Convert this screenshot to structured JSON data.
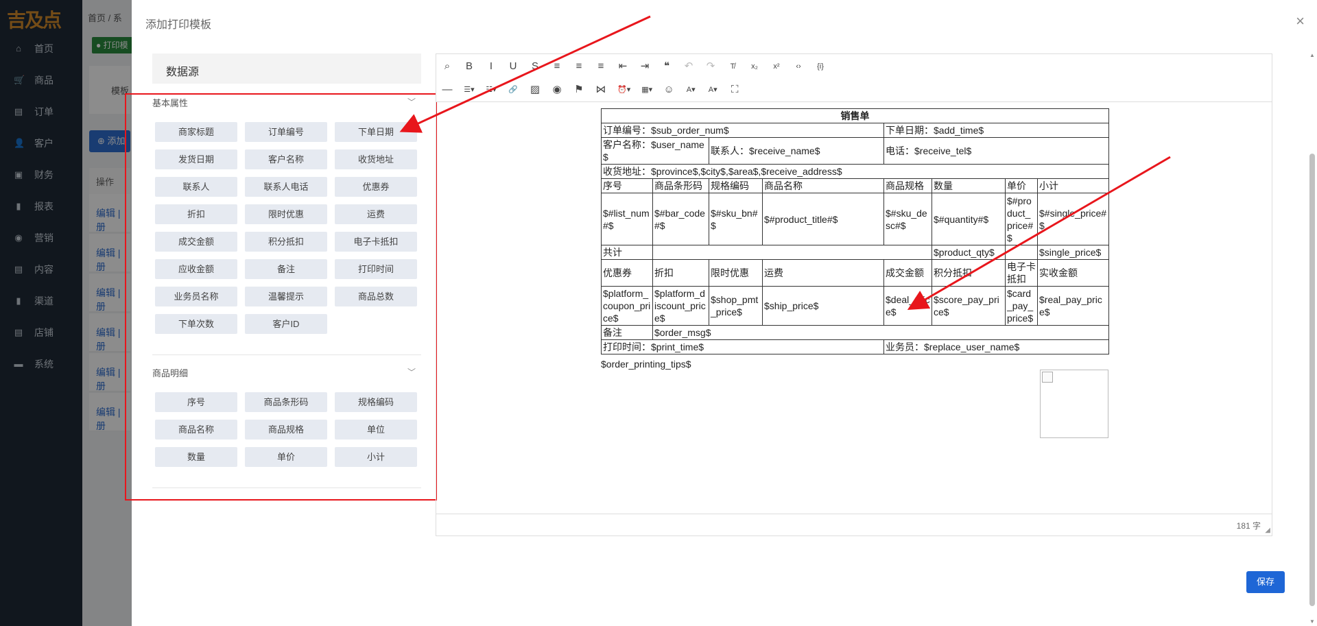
{
  "logo": "吉及点",
  "sidebar": {
    "items": [
      {
        "label": "首页",
        "icon": "home-icon",
        "glyph": "⌂"
      },
      {
        "label": "商品",
        "icon": "cart-icon",
        "glyph": "🛒"
      },
      {
        "label": "订单",
        "icon": "order-icon",
        "glyph": "▤"
      },
      {
        "label": "客户",
        "icon": "user-icon",
        "glyph": "👤"
      },
      {
        "label": "财务",
        "icon": "finance-icon",
        "glyph": "▣"
      },
      {
        "label": "报表",
        "icon": "report-icon",
        "glyph": "▮"
      },
      {
        "label": "营销",
        "icon": "marketing-icon",
        "glyph": "◉"
      },
      {
        "label": "内容",
        "icon": "content-icon",
        "glyph": "▤"
      },
      {
        "label": "渠道",
        "icon": "channel-icon",
        "glyph": "▮"
      },
      {
        "label": "店铺",
        "icon": "store-icon",
        "glyph": "▤"
      },
      {
        "label": "系统",
        "icon": "system-icon",
        "glyph": "▬"
      }
    ]
  },
  "background": {
    "breadcrumb": "首页 / 系",
    "tag": "● 打印模",
    "card_label": "模板",
    "add_button": "⊕ 添加",
    "table_header": "操作",
    "row_action": "编辑 | 册"
  },
  "dialog": {
    "title": "添加打印模板",
    "close_glyph": "×",
    "datasource_title": "数据源",
    "sections": [
      {
        "title": "基本属性",
        "fields": [
          "商家标题",
          "订单编号",
          "下单日期",
          "发货日期",
          "客户名称",
          "收货地址",
          "联系人",
          "联系人电话",
          "优惠券",
          "折扣",
          "限时优惠",
          "运费",
          "成交金额",
          "积分抵扣",
          "电子卡抵扣",
          "应收金额",
          "备注",
          "打印时间",
          "业务员名称",
          "温馨提示",
          "商品总数",
          "下单次数",
          "客户ID"
        ]
      },
      {
        "title": "商品明细",
        "fields": [
          "序号",
          "商品条形码",
          "规格编码",
          "商品名称",
          "商品规格",
          "单位",
          "数量",
          "单价",
          "小计"
        ]
      }
    ],
    "save_label": "保存"
  },
  "editor": {
    "word_count": "181 字",
    "toolbar_row1": [
      {
        "name": "find-icon",
        "glyph": "⌕"
      },
      {
        "name": "bold-icon",
        "glyph": "B"
      },
      {
        "name": "italic-icon",
        "glyph": "I"
      },
      {
        "name": "underline-icon",
        "glyph": "U"
      },
      {
        "name": "strikethrough-icon",
        "glyph": "S"
      },
      {
        "name": "align-left-icon",
        "glyph": "≡"
      },
      {
        "name": "align-center-icon",
        "glyph": "≡"
      },
      {
        "name": "align-right-icon",
        "glyph": "≡"
      },
      {
        "name": "outdent-icon",
        "glyph": "⇤"
      },
      {
        "name": "indent-icon",
        "glyph": "⇥"
      },
      {
        "name": "blockquote-icon",
        "glyph": "❝"
      },
      {
        "name": "undo-icon",
        "glyph": "↶",
        "disabled": true
      },
      {
        "name": "redo-icon",
        "glyph": "↷",
        "disabled": true
      },
      {
        "name": "clear-format-icon",
        "glyph": "T̸"
      },
      {
        "name": "subscript-icon",
        "glyph": "x₂"
      },
      {
        "name": "superscript-icon",
        "glyph": "x²"
      },
      {
        "name": "code-icon",
        "glyph": "‹›"
      },
      {
        "name": "source-icon",
        "glyph": "{i}"
      }
    ],
    "toolbar_row2": [
      {
        "name": "horizontal-rule-icon",
        "glyph": "—"
      },
      {
        "name": "bullet-list-icon",
        "glyph": "☰▾"
      },
      {
        "name": "numbered-list-icon",
        "glyph": "☷▾"
      },
      {
        "name": "link-icon",
        "glyph": "🔗"
      },
      {
        "name": "image-icon",
        "glyph": "▨"
      },
      {
        "name": "preview-icon",
        "glyph": "◉"
      },
      {
        "name": "bookmark-icon",
        "glyph": "⚑"
      },
      {
        "name": "page-break-icon",
        "glyph": "⋈"
      },
      {
        "name": "datetime-icon",
        "glyph": "⏰▾"
      },
      {
        "name": "table-icon",
        "glyph": "▦▾"
      },
      {
        "name": "emoji-icon",
        "glyph": "☺"
      },
      {
        "name": "font-color-icon",
        "glyph": "A▾"
      },
      {
        "name": "background-color-icon",
        "glyph": "A▾"
      },
      {
        "name": "fullscreen-icon",
        "glyph": "⛶"
      }
    ],
    "doc": {
      "title": "销售单",
      "order_no": "订单编号：$sub_order_num$",
      "order_date": "下单日期：$add_time$",
      "customer_name": "客户名称：$user_name$",
      "contact": "联系人：$receive_name$",
      "phone": "电话：$receive_tel$",
      "address": "收货地址：$province$,$city$,$area$,$receive_address$",
      "item_headers": [
        "序号",
        "商品条形码",
        "规格编码",
        "商品名称",
        "商品规格",
        "数量",
        "单价",
        "小计"
      ],
      "item_row": [
        "$#list_num#$",
        "$#bar_code#$",
        "$#sku_bn#$",
        "$#product_title#$",
        "$#sku_desc#$",
        "$#quantity#$",
        "$#product_price#$",
        "$#single_price#$"
      ],
      "total_label": "共计",
      "total_qty": "$product_qty$",
      "total_price": "$single_price$",
      "fee_headers": [
        "优惠券",
        "折扣",
        "限时优惠",
        "运费",
        "成交金额",
        "积分抵扣",
        "电子卡抵扣",
        "实收金额"
      ],
      "fee_values": [
        "$platform_coupon_price$",
        "$platform_discount_price$",
        "$shop_pmt_price$",
        "$ship_price$",
        "$deal_price$",
        "$score_pay_price$",
        "$card_pay_price$",
        "$real_pay_price$"
      ],
      "remark_label": "备注",
      "remark_value": "$order_msg$",
      "print_time": "打印时间：$print_time$",
      "salesman": "业务员：$replace_user_name$",
      "tips": "$order_printing_tips$"
    }
  },
  "colors": {
    "annotation_red": "#e8161c",
    "primary": "#1e66d6",
    "sidebar_bg": "#1f2b38"
  }
}
